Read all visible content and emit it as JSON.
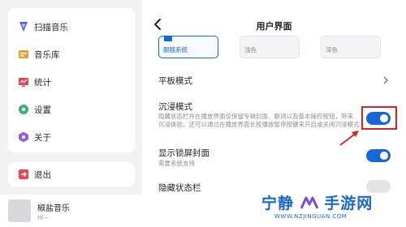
{
  "sidebar": {
    "items": [
      {
        "label": "扫描音乐",
        "icon": "scan-music-icon",
        "color": "#4a63e8"
      },
      {
        "label": "音乐库",
        "icon": "music-library-icon",
        "color": "#f29a38"
      },
      {
        "label": "统计",
        "icon": "statistics-icon",
        "color": "#e8454e"
      },
      {
        "label": "设置",
        "icon": "settings-icon",
        "color": "#33b36b"
      },
      {
        "label": "关于",
        "icon": "about-icon",
        "color": "#8c63e8"
      }
    ],
    "exit": {
      "label": "退出",
      "icon": "exit-icon",
      "color": "#e8454e"
    }
  },
  "player": {
    "title": "椒盐音乐",
    "subtitle": "Hi~"
  },
  "header": {
    "title": "用户界面"
  },
  "theme_options": [
    {
      "label": "跟随系统",
      "selected": true
    },
    {
      "label": "浅色",
      "selected": false
    },
    {
      "label": "深色",
      "selected": false
    }
  ],
  "settings": {
    "tablet_mode": {
      "title": "平板模式"
    },
    "immersive_mode": {
      "title": "沉浸模式",
      "desc_line1": "隐藏状态栏并在播放界面仅保留专辑封面、歌词以及基本操控按钮，带来",
      "desc_line2": "沉浸体验。还可以通过在播放界面长按播放暂停按键来开启或关闭沉浸模式",
      "enabled": true
    },
    "lockscreen_cover": {
      "title": "显示锁屏封面",
      "desc": "需要系统支持",
      "enabled": true
    },
    "hide_statusbar": {
      "title": "隐藏状态栏",
      "enabled": false
    }
  },
  "colors": {
    "accent": "#1768d6",
    "annotation": "#e02020"
  },
  "watermark": {
    "text_left": "宁静",
    "text_right": "手游网",
    "url": "WWW.NZJINGUAN.COM"
  }
}
